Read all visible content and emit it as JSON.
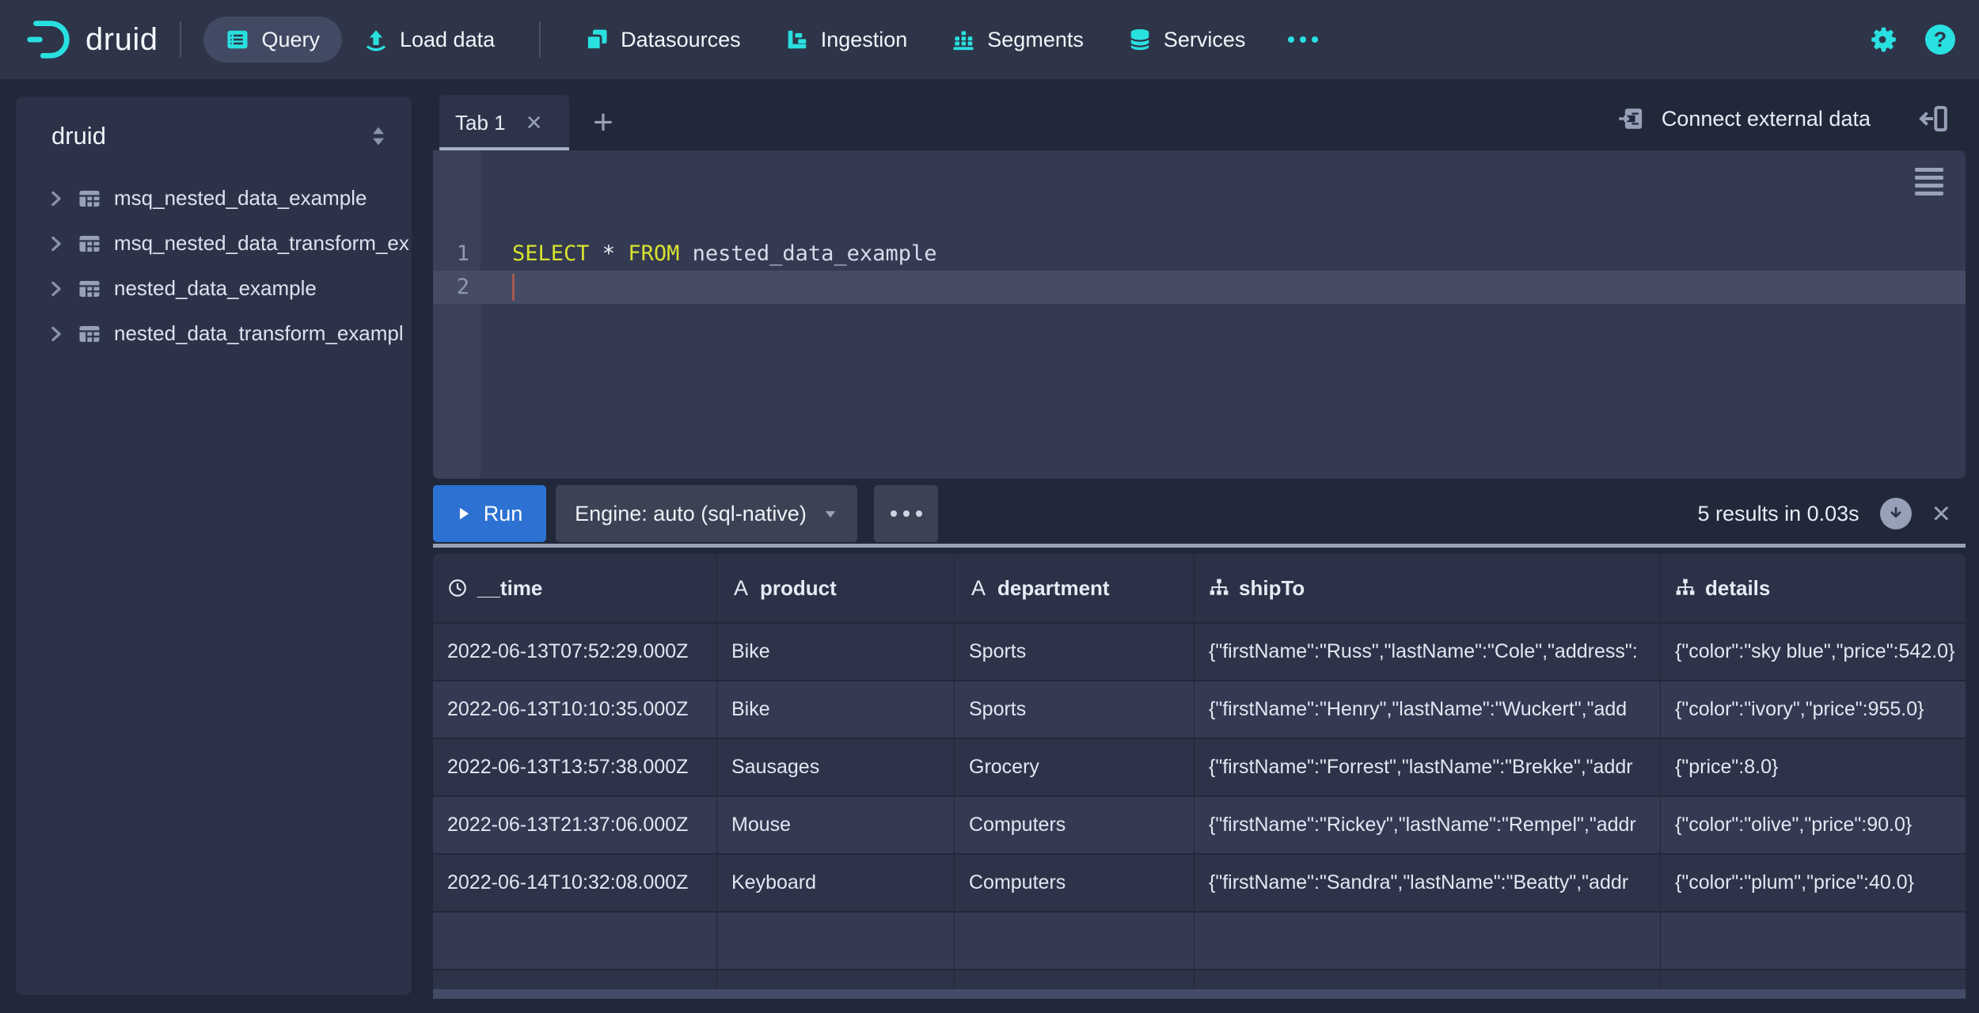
{
  "glyphs": {
    "close": "×",
    "plus": "+",
    "help": "?"
  },
  "colors": {
    "accent_cyan": "#29e0e0",
    "run_blue": "#2d72d2",
    "keyword_yellow": "#d8e22e",
    "nav_bg": "#2e3548",
    "panel_bg": "#2c3349"
  },
  "nav": {
    "logo_text": "druid",
    "items": [
      {
        "label": "Query",
        "active": true
      },
      {
        "label": "Load data",
        "active": false
      },
      {
        "label": "Datasources",
        "active": false
      },
      {
        "label": "Ingestion",
        "active": false
      },
      {
        "label": "Segments",
        "active": false
      },
      {
        "label": "Services",
        "active": false
      }
    ]
  },
  "sidebar": {
    "title": "druid",
    "datasources": [
      {
        "name": "msq_nested_data_example"
      },
      {
        "name": "msq_nested_data_transform_ex"
      },
      {
        "name": "nested_data_example"
      },
      {
        "name": "nested_data_transform_exampl"
      }
    ]
  },
  "tabs": {
    "active_tab": "Tab 1"
  },
  "connect": {
    "label": "Connect external data"
  },
  "editor": {
    "line_numbers": [
      "1",
      "2"
    ],
    "tokens": [
      {
        "text": "SELECT",
        "type": "keyword"
      },
      {
        "text": " * ",
        "type": "plain"
      },
      {
        "text": "FROM",
        "type": "keyword"
      },
      {
        "text": " nested_data_example",
        "type": "identifier"
      }
    ]
  },
  "runbar": {
    "run_label": "Run",
    "engine_label": "Engine: auto (sql-native)",
    "results_summary": "5 results in 0.03s"
  },
  "results_table": {
    "columns": [
      {
        "label": "__time",
        "type": "time"
      },
      {
        "label": "product",
        "type": "string",
        "type_glyph": "A"
      },
      {
        "label": "department",
        "type": "string",
        "type_glyph": "A"
      },
      {
        "label": "shipTo",
        "type": "nested"
      },
      {
        "label": "details",
        "type": "nested"
      }
    ],
    "rows": [
      {
        "__time": "2022-06-13T07:52:29.000Z",
        "product": "Bike",
        "department": "Sports",
        "shipTo": "{\"firstName\":\"Russ\",\"lastName\":\"Cole\",\"address\":",
        "details": "{\"color\":\"sky blue\",\"price\":542.0}"
      },
      {
        "__time": "2022-06-13T10:10:35.000Z",
        "product": "Bike",
        "department": "Sports",
        "shipTo": "{\"firstName\":\"Henry\",\"lastName\":\"Wuckert\",\"add",
        "details": "{\"color\":\"ivory\",\"price\":955.0}"
      },
      {
        "__time": "2022-06-13T13:57:38.000Z",
        "product": "Sausages",
        "department": "Grocery",
        "shipTo": "{\"firstName\":\"Forrest\",\"lastName\":\"Brekke\",\"addr",
        "details": "{\"price\":8.0}"
      },
      {
        "__time": "2022-06-13T21:37:06.000Z",
        "product": "Mouse",
        "department": "Computers",
        "shipTo": "{\"firstName\":\"Rickey\",\"lastName\":\"Rempel\",\"addr",
        "details": "{\"color\":\"olive\",\"price\":90.0}"
      },
      {
        "__time": "2022-06-14T10:32:08.000Z",
        "product": "Keyboard",
        "department": "Computers",
        "shipTo": "{\"firstName\":\"Sandra\",\"lastName\":\"Beatty\",\"addr",
        "details": "{\"color\":\"plum\",\"price\":40.0}"
      }
    ]
  }
}
